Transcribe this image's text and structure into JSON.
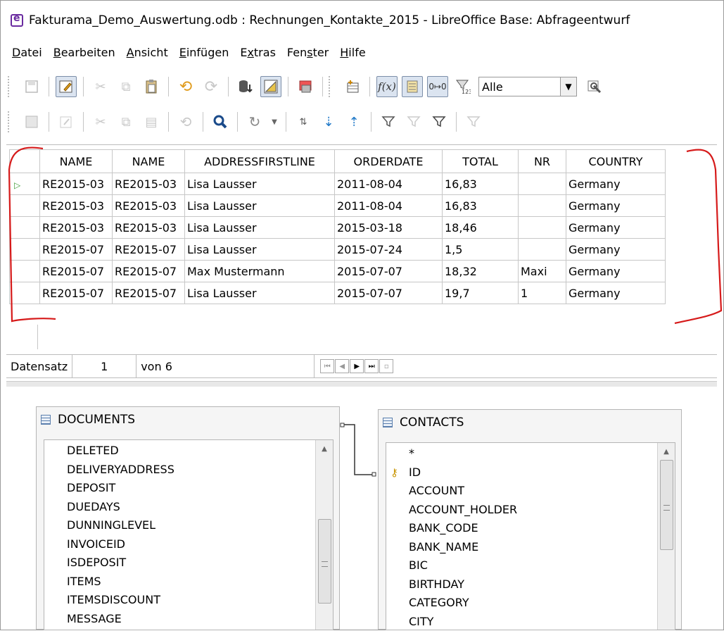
{
  "window": {
    "title": "Fakturama_Demo_Auswertung.odb : Rechnungen_Kontakte_2015 - LibreOffice Base: Abfrageentwurf"
  },
  "menu": [
    {
      "label": "Datei"
    },
    {
      "label": "Bearbeiten"
    },
    {
      "label": "Ansicht"
    },
    {
      "label": "Einfügen"
    },
    {
      "label": "Extras"
    },
    {
      "label": "Fenster"
    },
    {
      "label": "Hilfe"
    }
  ],
  "toolbar": {
    "limit_value": "Alle"
  },
  "grid": {
    "columns": [
      "NAME",
      "NAME",
      "ADDRESSFIRSTLINE",
      "ORDERDATE",
      "TOTAL",
      "NR",
      "COUNTRY"
    ],
    "rows": [
      [
        "RE2015-03",
        "RE2015-03",
        "Lisa Lausser",
        "2011-08-04",
        "16,83",
        "",
        "Germany"
      ],
      [
        "RE2015-03",
        "RE2015-03",
        "Lisa Lausser",
        "2011-08-04",
        "16,83",
        "",
        "Germany"
      ],
      [
        "RE2015-03",
        "RE2015-03",
        "Lisa Lausser",
        "2015-03-18",
        "18,46",
        "",
        "Germany"
      ],
      [
        "RE2015-07",
        "RE2015-07",
        "Lisa Lausser",
        "2015-07-24",
        "1,5",
        "",
        "Germany"
      ],
      [
        "RE2015-07",
        "RE2015-07",
        "Max Mustermann",
        "2015-07-07",
        "18,32",
        "Maxi",
        "Germany"
      ],
      [
        "RE2015-07",
        "RE2015-07",
        "Lisa Lausser",
        "2015-07-07",
        "19,7",
        "1",
        "Germany"
      ]
    ]
  },
  "navigation": {
    "label": "Datensatz",
    "current": "1",
    "of": "von 6"
  },
  "tables": {
    "documents": {
      "name": "DOCUMENTS",
      "fields": [
        "DELETED",
        "DELIVERYADDRESS",
        "DEPOSIT",
        "DUEDAYS",
        "DUNNINGLEVEL",
        "INVOICEID",
        "ISDEPOSIT",
        "ITEMS",
        "ITEMSDISCOUNT",
        "MESSAGE"
      ]
    },
    "contacts": {
      "name": "CONTACTS",
      "fields": [
        "*",
        "ID",
        "ACCOUNT",
        "ACCOUNT_HOLDER",
        "BANK_CODE",
        "BANK_NAME",
        "BIC",
        "BIRTHDAY",
        "CATEGORY",
        "CITY"
      ]
    }
  }
}
